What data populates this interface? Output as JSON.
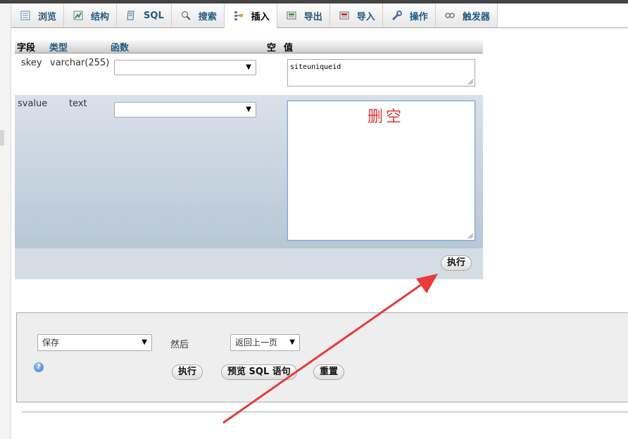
{
  "tabs": [
    {
      "label": "浏览",
      "icon": "browse-icon",
      "active": false
    },
    {
      "label": "结构",
      "icon": "structure-icon",
      "active": false
    },
    {
      "label": "SQL",
      "icon": "sql-icon",
      "active": false
    },
    {
      "label": "搜索",
      "icon": "search-icon",
      "active": false
    },
    {
      "label": "插入",
      "icon": "insert-icon",
      "active": true
    },
    {
      "label": "导出",
      "icon": "export-icon",
      "active": false
    },
    {
      "label": "导入",
      "icon": "import-icon",
      "active": false
    },
    {
      "label": "操作",
      "icon": "wrench-icon",
      "active": false
    },
    {
      "label": "触发器",
      "icon": "trigger-icon",
      "active": false
    }
  ],
  "table_header": {
    "field": "字段",
    "type": "类型",
    "function": "函数",
    "null": "空",
    "value": "值"
  },
  "rows": [
    {
      "field": "skey",
      "type": "varchar(255)",
      "function": "",
      "value": "siteuniqueid"
    },
    {
      "field": "svalue",
      "type": "text",
      "function": "",
      "value": ""
    }
  ],
  "annotation": "删空",
  "go_button": "执行",
  "lower": {
    "action_select": "保存",
    "then_label": "然后",
    "after_select": "返回上一页",
    "go_button": "执行",
    "preview_button": "预览 SQL 语句",
    "reset_button": "重置"
  },
  "colors": {
    "annotation": "#e33434",
    "link": "#235a81",
    "row_highlight": "#b7c7d6"
  }
}
